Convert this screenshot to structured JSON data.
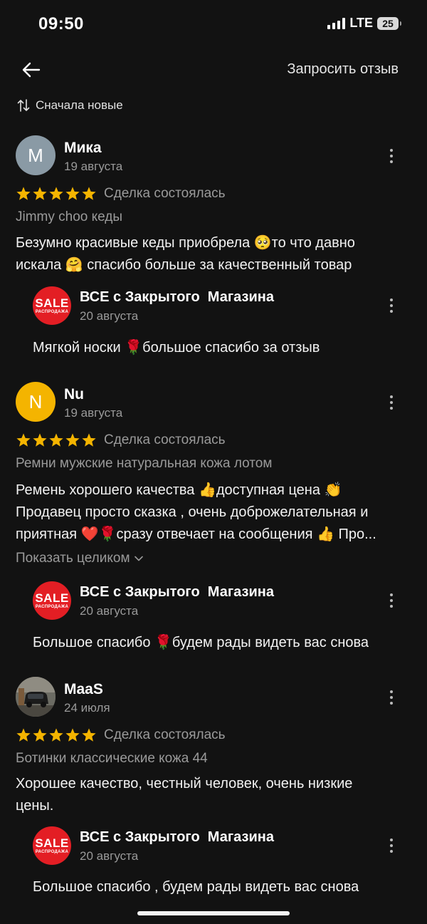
{
  "status_bar": {
    "time": "09:50",
    "network": "LTE",
    "battery": "25"
  },
  "header": {
    "back_icon": "arrow-left-icon",
    "request_review_label": "Запросить отзыв"
  },
  "sort": {
    "icon": "sort-arrows-icon",
    "label": "Сначала новые"
  },
  "reviews": [
    {
      "avatar_letter": "М",
      "avatar_color": "#8a9aa5",
      "user": "Мика",
      "date": "19 августа",
      "rating": 5,
      "status": "Сделка состоялась",
      "product": "Jimmy choo кеды",
      "text_line1": "Безумно красивые кеды приобрела 🥺то что давно",
      "text_line2": "искала 🤗 спасибо больше за качественный товар",
      "reply": {
        "seller": "ВСЕ с Закрытого  Магазина",
        "date": "20 августа",
        "text": "Мягкой носки 🌹большое спасибо за отзыв"
      }
    },
    {
      "avatar_letter": "N",
      "avatar_color": "#f4b400",
      "user": "Nu",
      "date": "19 августа",
      "rating": 5,
      "status": "Сделка состоялась",
      "product": "Ремни мужские натуральная кожа лотом",
      "text_line1": "Ремень хорошего качества 👍доступная цена 👏",
      "text_line2": "Продавец просто сказка , очень доброжелательная и",
      "text_line3": "приятная ❤️🌹сразу отвечает на сообщения 👍 Про...",
      "show_more": "Показать целиком",
      "reply": {
        "seller": "ВСЕ с Закрытого  Магазина",
        "date": "20 августа",
        "text": "Большое спасибо 🌹будем рады видеть вас снова"
      }
    },
    {
      "avatar_letter": "",
      "avatar_color": "#5a5a55",
      "user": "MaaS",
      "date": "24 июля",
      "rating": 5,
      "status": "Сделка состоялась",
      "product": "Ботинки классические кожа 44",
      "text_line1": "Хорошее качество, честный человек, очень низкие",
      "text_line2": "цены.",
      "reply": {
        "seller": "ВСЕ с Закрытого  Магазина",
        "date": "20 августа",
        "text": "Большое спасибо , будем рады видеть вас снова"
      }
    }
  ],
  "seller_logo": {
    "main": "SALE",
    "sub": "РАСПРОДАЖА",
    "color": "#e31e24"
  },
  "colors": {
    "background": "#121212",
    "star": "#f4b400",
    "secondary_text": "#9a9a9a"
  }
}
